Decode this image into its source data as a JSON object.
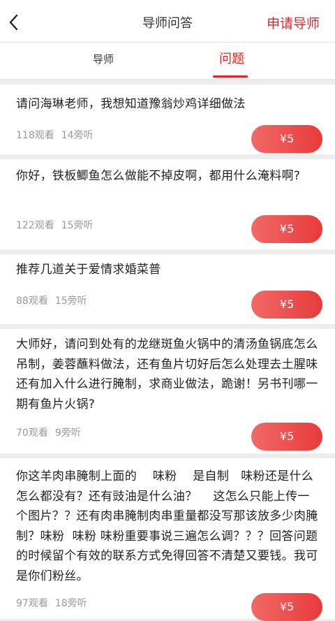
{
  "header": {
    "title": "导师问答",
    "apply_label": "申请导师"
  },
  "tabs": [
    {
      "label": "导师",
      "active": false
    },
    {
      "label": "问题",
      "active": true
    }
  ],
  "colors": {
    "accent": "#e02828",
    "price_button_start": "#f16a66",
    "price_button_end": "#e83a3b",
    "background": "#ededed"
  },
  "questions": [
    {
      "text": "请问海琳老师，我想知道豫翁炒鸡详细做法",
      "views": "118观看",
      "listeners": "14旁听",
      "price": "¥5"
    },
    {
      "text": "你好，铁板鲫鱼怎么做能不掉皮啊，都用什么淹料啊?",
      "views": "122观看",
      "listeners": "15旁听",
      "price": "¥5"
    },
    {
      "text": "推荐几道关于爱情求婚菜普",
      "views": "88观看",
      "listeners": "15旁听",
      "price": "¥5"
    },
    {
      "text": "大师好，请问到处有的龙继斑鱼火锅中的清汤鱼锅底怎么吊制，姜蓉蘸料做法，还有鱼片切好后怎么处理去土腥味还有加入什么进行腌制，求商业做法，跪谢！另书刊哪一期有鱼片火锅?",
      "views": "70观看",
      "listeners": "9旁听",
      "price": "¥5"
    },
    {
      "text": "你这羊肉串腌制上面的    味粉    是自制   味粉还是什么怎么都没有？还有豉油是什么油？    这怎么只能上传一个图片？？还有肉串腌制肉串重量都没写那该放多少肉腌制？味粉  味粉 味粉重要事说三遍怎么调？？？回答问题的时候留个有效的联系方式免得回答不清楚又要钱。我可是你们粉丝。",
      "views": "97观看",
      "listeners": "18旁听",
      "price": "¥5"
    }
  ]
}
